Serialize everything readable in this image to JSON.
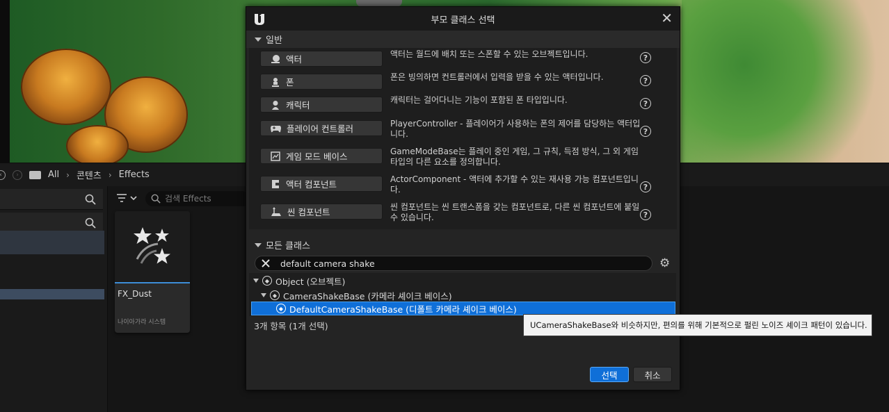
{
  "breadcrumb": {
    "items": [
      "All",
      "콘텐츠",
      "Effects"
    ]
  },
  "assets": {
    "search_placeholder": "검색 Effects",
    "items": [
      {
        "name": "FX_Dust",
        "type": "나이아가라 시스템"
      }
    ]
  },
  "dialog": {
    "title": "부모 클래스 선택",
    "general_header": "일반",
    "general_items": [
      {
        "label": "액터",
        "icon": "actor-icon",
        "description": "액터는 월드에 배치 또는 스폰할 수 있는 오브젝트입니다.",
        "help": true
      },
      {
        "label": "폰",
        "icon": "pawn-icon",
        "description": "폰은 빙의하면 컨트롤러에서 입력을 받을 수 있는 액터입니다.",
        "help": true
      },
      {
        "label": "캐릭터",
        "icon": "character-icon",
        "description": "캐릭터는 걸어다니는 기능이 포함된 폰 타입입니다.",
        "help": true
      },
      {
        "label": "플레이어 컨트롤러",
        "icon": "gamepad-icon",
        "description": "PlayerController - 플레이어가 사용하는 폰의 제어를 담당하는 액터입니다.",
        "help": true
      },
      {
        "label": "게임 모드 베이스",
        "icon": "game-mode-icon",
        "description": "GameModeBase는 플레이 중인 게임, 그 규칙, 득점 방식, 그 외 게임 타입의 다른 요소를 정의합니다.",
        "help": false
      },
      {
        "label": "액터 컴포넌트",
        "icon": "component-icon",
        "description": "ActorComponent - 액터에 추가할 수 있는 재사용 가능 컴포넌트입니다.",
        "help": true
      },
      {
        "label": "씬 컴포넌트",
        "icon": "scene-component-icon",
        "description": "씬 컴포넌트는 씬 트랜스폼을 갖는 컴포넌트로, 다른 씬 컴포넌트에 붙일 수 있습니다.",
        "help": true
      }
    ],
    "all_classes_header": "모든 클래스",
    "search_value": "default camera shake",
    "tree": [
      {
        "label": "Object (오브젝트)",
        "depth": 0
      },
      {
        "label": "CameraShakeBase (카메라 셰이크 베이스)",
        "depth": 1
      },
      {
        "label": "DefaultCameraShakeBase (디폴트 카메라 셰이크 베이스)",
        "depth": 2,
        "selected": true
      }
    ],
    "count_text": "3개 항목 (1개 선택)",
    "select_label": "선택",
    "cancel_label": "취소"
  },
  "tooltip": {
    "text": "UCameraShakeBase와 비슷하지만, 편의를 위해 기본적으로 펄린 노이즈 셰이크 패턴이 있습니다."
  },
  "colors": {
    "accent": "#0f6fd8",
    "panel": "#242424",
    "background": "#151515"
  }
}
